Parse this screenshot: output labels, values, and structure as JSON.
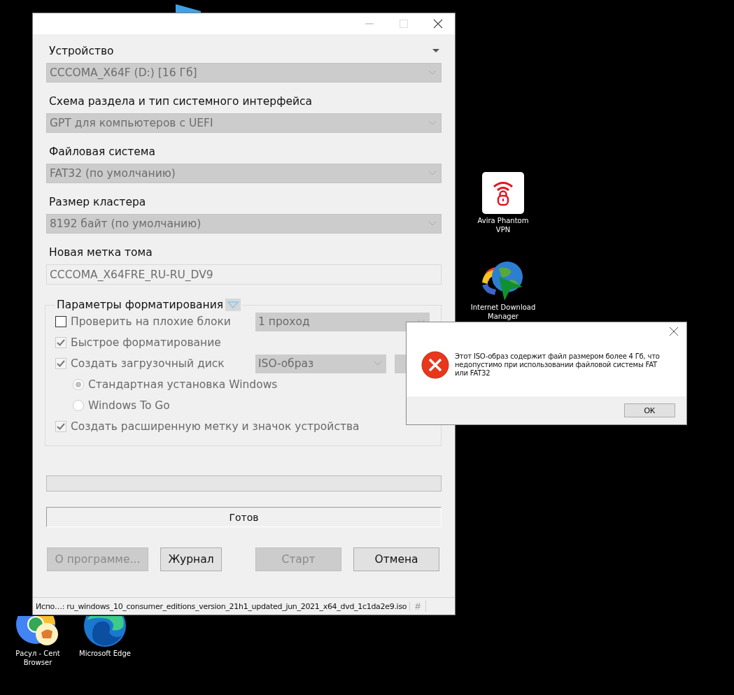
{
  "desktop_icons": [
    {
      "kind": "partial"
    },
    {
      "kind": "lock-wifi",
      "label": "Avira Phantom VPN"
    },
    {
      "kind": "globe",
      "label": "Internet Download Manager"
    },
    {
      "kind": "browser",
      "label": "Расул - Cent Browser"
    },
    {
      "kind": "swirl",
      "label": "Microsoft Edge"
    }
  ],
  "main_window": {
    "fields": [
      {
        "kind": "select",
        "label": "Устройство",
        "value": "CCCOMA_X64F (D:) [16 Гб]"
      },
      {
        "kind": "select",
        "label": "Схема раздела и тип системного интерфейса",
        "value": "GPT для компьютеров с UEFI"
      },
      {
        "kind": "select",
        "label": "Файловая система",
        "value": "FAT32 (по умолчанию)"
      },
      {
        "kind": "select",
        "label": "Размер кластера",
        "value": "8192 байт (по умолчанию)"
      },
      {
        "kind": "text",
        "label": "Новая метка тома",
        "value": "CCCOMA_X64FRE_RU-RU_DV9"
      }
    ],
    "format_options": {
      "title": "Параметры форматирования",
      "options": [
        {
          "kind": "checkbox",
          "label": "Проверить на плохие блоки",
          "checked": false,
          "disabled": false,
          "select": "1 проход"
        },
        {
          "kind": "checkbox",
          "label": "Быстрое форматирование",
          "checked": true,
          "disabled": true
        },
        {
          "kind": "checkbox",
          "label": "Создать загрузочный диск",
          "checked": true,
          "disabled": true,
          "select": "ISO-образ"
        },
        {
          "kind": "radio",
          "label": "Стандартная установка Windows",
          "checked": true,
          "disabled": true
        },
        {
          "kind": "radio",
          "label": "Windows To Go",
          "checked": false,
          "disabled": true
        },
        {
          "kind": "checkbox",
          "label": "Создать расширенную метку и значок устройства",
          "checked": true,
          "disabled": true
        }
      ]
    },
    "progress": {
      "level": 0
    },
    "status": "Готов",
    "buttons": [
      {
        "label": "О программе...",
        "disabled": true
      },
      {
        "label": "Журнал",
        "disabled": false
      },
      {
        "label": "Старт",
        "disabled": true
      },
      {
        "label": "Отмена",
        "disabled": false
      }
    ],
    "status_bar": {
      "text": "Испо…: ru_windows_10_consumer_editions_version_21h1_updated_jun_2021_x64_dvd_1c1da2e9.iso",
      "mark": "#"
    }
  },
  "dialog": {
    "message": "Этот ISO-образ содержит файл размером более 4 Гб, что недопустимо при использовании файловой системы FAT или FAT32",
    "button": "OK"
  }
}
